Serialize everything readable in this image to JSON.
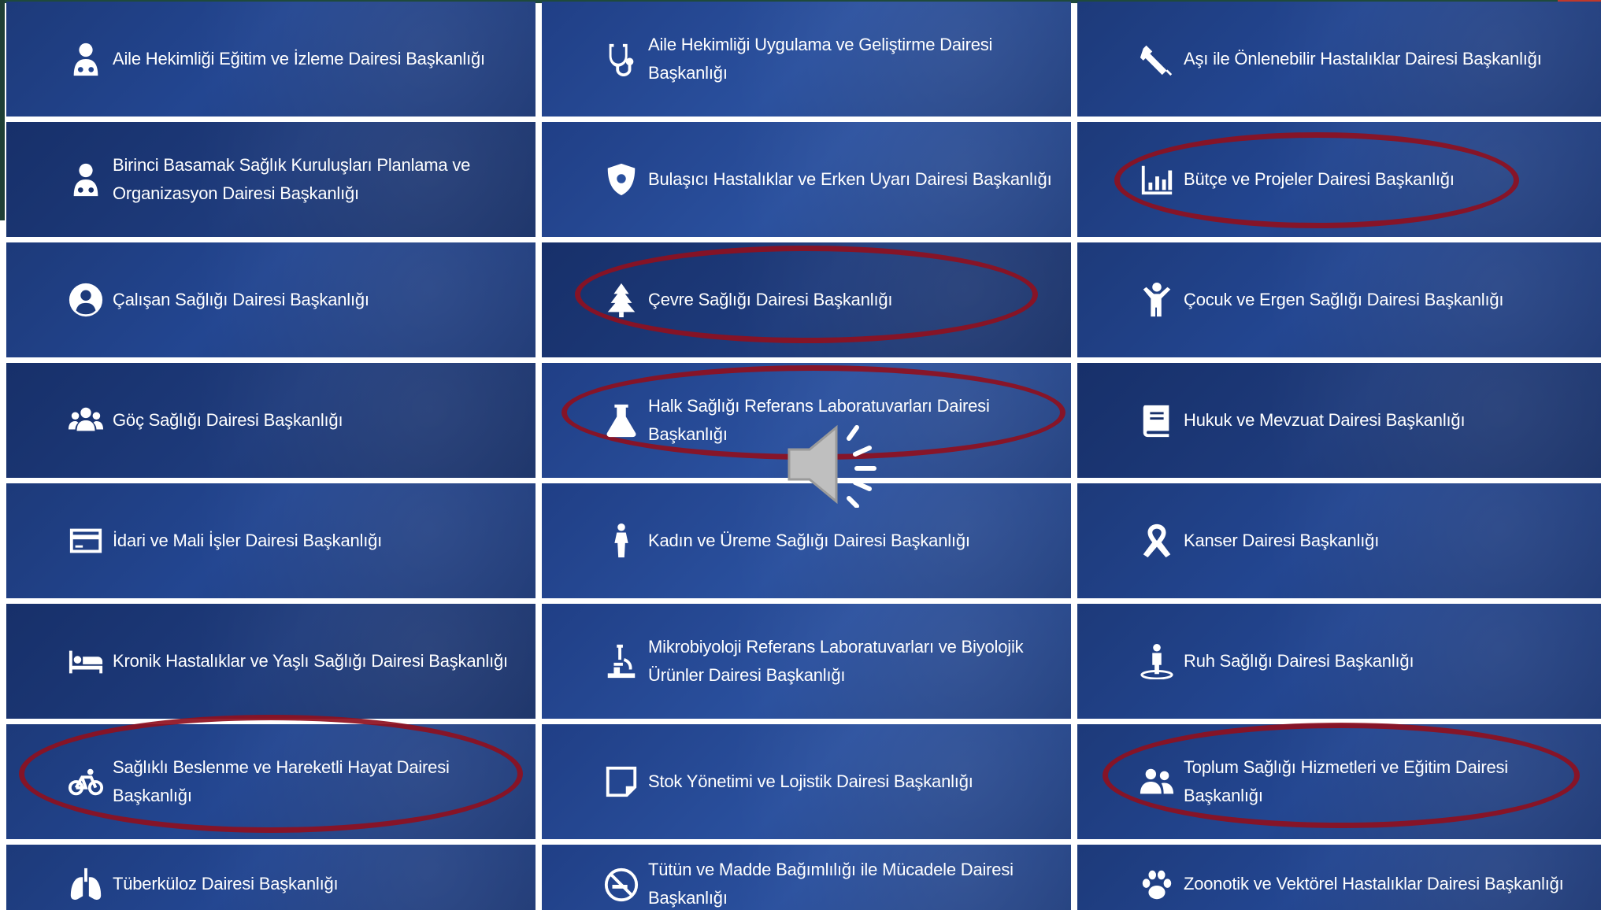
{
  "tiles": [
    {
      "label": "Aile Hekimliği Eğitim ve İzleme Dairesi Başkanlığı",
      "icon": "doctor-icon"
    },
    {
      "label": "Aile Hekimliği Uygulama ve Geliştirme Dairesi Başkanlığı",
      "icon": "stethoscope-icon"
    },
    {
      "label": "Aşı ile Önlenebilir Hastalıklar Dairesi Başkanlığı",
      "icon": "syringe-icon"
    },
    {
      "label": "Birinci Basamak Sağlık Kuruluşları Planlama ve Organizasyon Dairesi Başkanlığı",
      "icon": "doctor-icon"
    },
    {
      "label": "Bulaşıcı Hastalıklar ve Erken Uyarı Dairesi Başkanlığı",
      "icon": "shield-virus-icon"
    },
    {
      "label": "Bütçe ve Projeler Dairesi Başkanlığı",
      "icon": "bar-chart-icon"
    },
    {
      "label": "Çalışan Sağlığı Dairesi Başkanlığı",
      "icon": "user-circle-icon"
    },
    {
      "label": "Çevre Sağlığı Dairesi Başkanlığı",
      "icon": "tree-icon"
    },
    {
      "label": "Çocuk ve Ergen Sağlığı Dairesi Başkanlığı",
      "icon": "child-icon"
    },
    {
      "label": "Göç Sağlığı Dairesi Başkanlığı",
      "icon": "users-icon"
    },
    {
      "label": "Halk Sağlığı Referans Laboratuvarları Dairesi Başkanlığı",
      "icon": "flask-icon"
    },
    {
      "label": "Hukuk ve Mevzuat Dairesi Başkanlığı",
      "icon": "book-icon"
    },
    {
      "label": "İdari ve Mali İşler Dairesi Başkanlığı",
      "icon": "credit-card-icon"
    },
    {
      "label": "Kadın ve Üreme Sağlığı Dairesi Başkanlığı",
      "icon": "female-icon"
    },
    {
      "label": "Kanser Dairesi Başkanlığı",
      "icon": "ribbon-icon"
    },
    {
      "label": "Kronik Hastalıklar ve Yaşlı Sağlığı Dairesi Başkanlığı",
      "icon": "bed-icon"
    },
    {
      "label": "Mikrobiyoloji Referans Laboratuvarları ve Biyolojik Ürünler Dairesi Başkanlığı",
      "icon": "microscope-icon"
    },
    {
      "label": "Ruh Sağlığı Dairesi Başkanlığı",
      "icon": "person-circle-icon"
    },
    {
      "label": "Sağlıklı Beslenme ve Hareketli Hayat Dairesi Başkanlığı",
      "icon": "bicycle-icon"
    },
    {
      "label": "Stok Yönetimi ve Lojistik Dairesi Başkanlığı",
      "icon": "sticky-note-icon"
    },
    {
      "label": "Toplum Sağlığı Hizmetleri ve Eğitim Dairesi Başkanlığı",
      "icon": "user-group-icon"
    },
    {
      "label": "Tüberküloz Dairesi Başkanlığı",
      "icon": "lungs-icon"
    },
    {
      "label": "Tütün ve Madde Bağımlılığı ile Mücadele Dairesi Başkanlığı",
      "icon": "no-smoking-icon"
    },
    {
      "label": "Zoonotik ve Vektörel Hastalıklar Dairesi Başkanlığı",
      "icon": "paw-icon"
    }
  ],
  "highlighted": [
    "Bütçe ve Projeler Dairesi Başkanlığı",
    "Çevre Sağlığı Dairesi Başkanlığı",
    "Halk Sağlığı Referans Laboratuvarları Dairesi Başkanlığı",
    "Sağlıklı Beslenme ve Hareketli Hayat Dairesi Başkanlığı",
    "Toplum Sağlığı Hizmetleri ve Eğitim Dairesi Başkanlığı"
  ],
  "colors": {
    "tile": "#234691",
    "text": "#ffffff",
    "highlight": "#8e1020"
  },
  "overlay_icon": "speaker-icon"
}
